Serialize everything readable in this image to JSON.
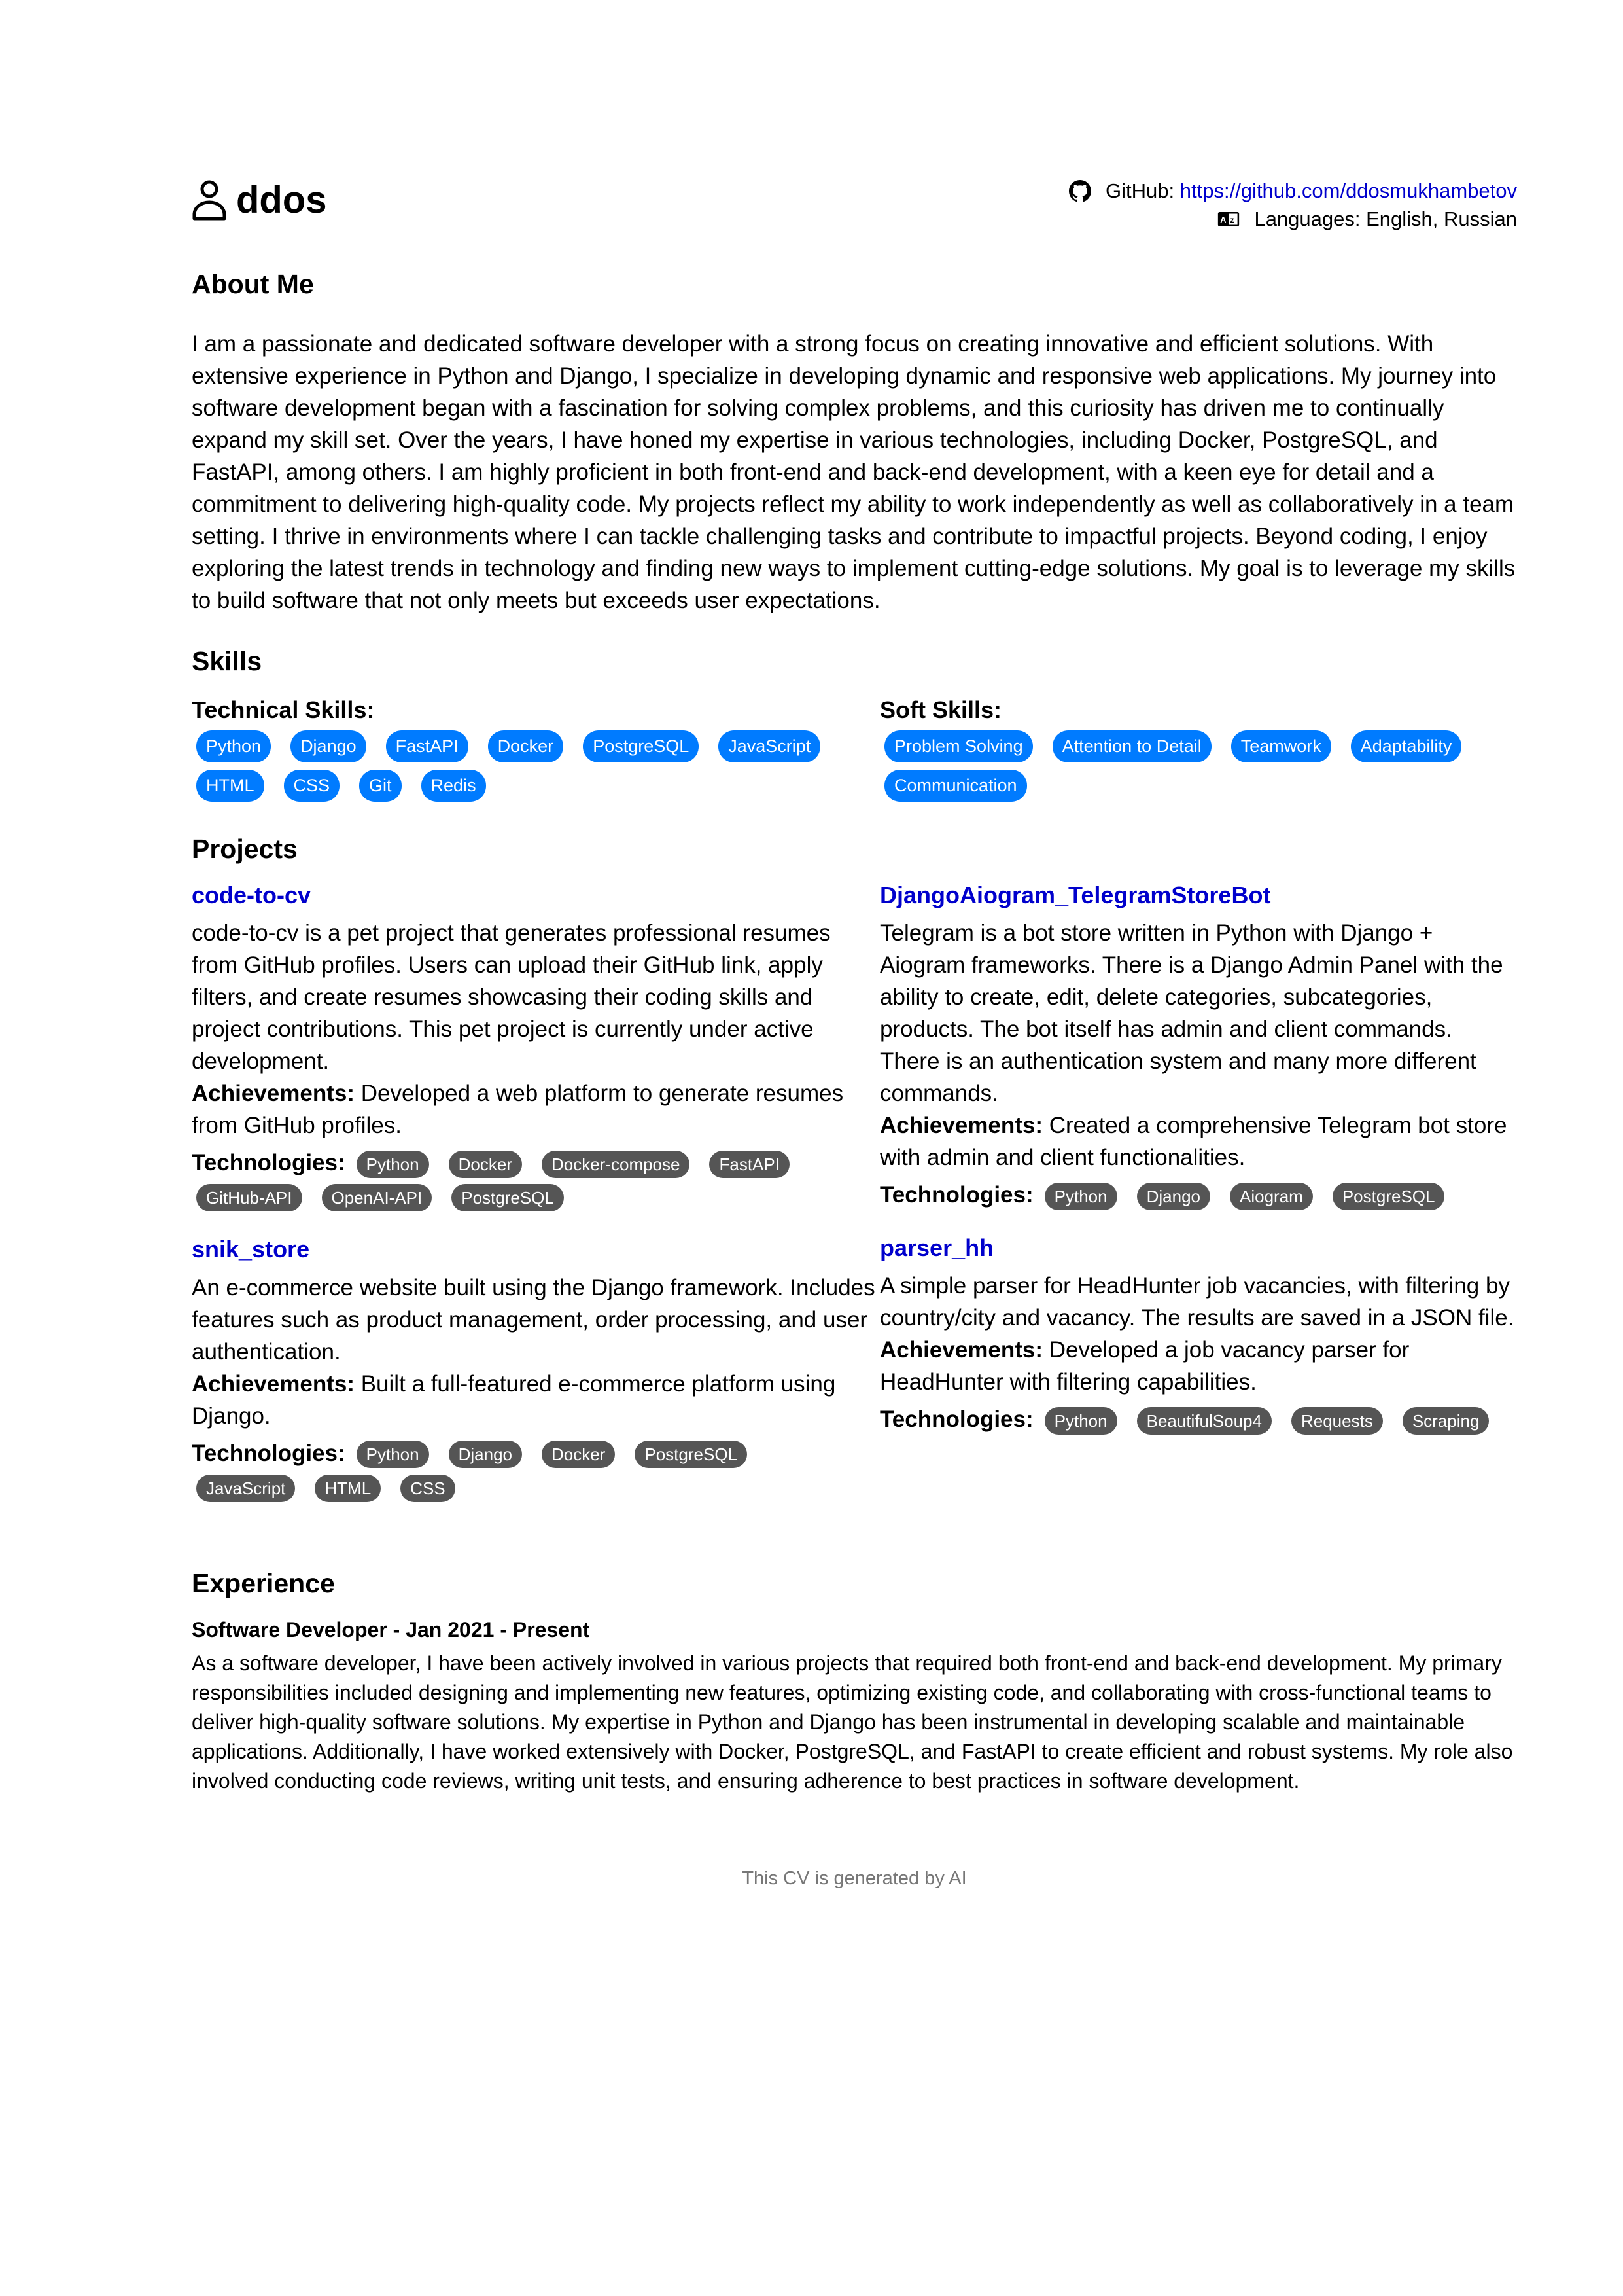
{
  "header": {
    "name": "ddos",
    "github_label": "GitHub: ",
    "github_url": "https://github.com/ddosmukhambetov",
    "languages_label": "Languages: English, Russian"
  },
  "about": {
    "title": "About Me",
    "text": "I am a passionate and dedicated software developer with a strong focus on creating innovative and efficient solutions. With extensive experience in Python and Django, I specialize in developing dynamic and responsive web applications. My journey into software development began with a fascination for solving complex problems, and this curiosity has driven me to continually expand my skill set. Over the years, I have honed my expertise in various technologies, including Docker, PostgreSQL, and FastAPI, among others. I am highly proficient in both front-end and back-end development, with a keen eye for detail and a commitment to delivering high-quality code. My projects reflect my ability to work independently as well as collaboratively in a team setting. I thrive in environments where I can tackle challenging tasks and contribute to impactful projects. Beyond coding, I enjoy exploring the latest trends in technology and finding new ways to implement cutting-edge solutions. My goal is to leverage my skills to build software that not only meets but exceeds user expectations."
  },
  "skills": {
    "title": "Skills",
    "technical_title": "Technical Skills:",
    "technical": [
      "Python",
      "Django",
      "FastAPI",
      "Docker",
      "PostgreSQL",
      "JavaScript",
      "HTML",
      "CSS",
      "Git",
      "Redis"
    ],
    "soft_title": "Soft Skills:",
    "soft": [
      "Problem Solving",
      "Attention to Detail",
      "Teamwork",
      "Adaptability",
      "Communication"
    ]
  },
  "projects": {
    "title": "Projects",
    "achievements_label": "Achievements:",
    "technologies_label": "Technologies:",
    "items": [
      {
        "name": "code-to-cv",
        "description": "code-to-cv is a pet project that generates professional resumes from GitHub profiles. Users can upload their GitHub link, apply filters, and create resumes showcasing their coding skills and project contributions. This pet project is currently under active development.",
        "achievements": "Developed a web platform to generate resumes from GitHub profiles.",
        "technologies": [
          "Python",
          "Docker",
          "Docker-compose",
          "FastAPI",
          "GitHub-API",
          "OpenAI-API",
          "PostgreSQL"
        ]
      },
      {
        "name": "DjangoAiogram_TelegramStoreBot",
        "description": "Telegram is a bot store written in Python with Django + Aiogram frameworks. There is a Django Admin Panel with the ability to create, edit, delete categories, subcategories, products. The bot itself has admin and client commands. There is an authentication system and many more different commands.",
        "achievements": "Created a comprehensive Telegram bot store with admin and client functionalities.",
        "technologies": [
          "Python",
          "Django",
          "Aiogram",
          "PostgreSQL"
        ]
      },
      {
        "name": "snik_store",
        "description": "An e-commerce website built using the Django framework. Includes features such as product management, order processing, and user authentication.",
        "achievements": "Built a full-featured e-commerce platform using Django.",
        "technologies": [
          "Python",
          "Django",
          "Docker",
          "PostgreSQL",
          "JavaScript",
          "HTML",
          "CSS"
        ]
      },
      {
        "name": "parser_hh",
        "description": "A simple parser for HeadHunter job vacancies, with filtering by country/city and vacancy. The results are saved in a JSON file.",
        "achievements": "Developed a job vacancy parser for HeadHunter with filtering capabilities.",
        "technologies": [
          "Python",
          "BeautifulSoup4",
          "Requests",
          "Scraping"
        ]
      }
    ]
  },
  "experience": {
    "title": "Experience",
    "jobs": [
      {
        "title": "Software Developer - Jan 2021 - Present",
        "description": "As a software developer, I have been actively involved in various projects that required both front-end and back-end development. My primary responsibilities included designing and implementing new features, optimizing existing code, and collaborating with cross-functional teams to deliver high-quality software solutions. My expertise in Python and Django has been instrumental in developing scalable and maintainable applications. Additionally, I have worked extensively with Docker, PostgreSQL, and FastAPI to create efficient and robust systems. My role also involved conducting code reviews, writing unit tests, and ensuring adherence to best practices in software development."
      }
    ]
  },
  "footer": {
    "text": "This CV is generated by AI"
  },
  "colors": {
    "link": "#0000cc",
    "skill_pill": "#007bff",
    "tech_pill": "#555555",
    "footer_text": "#777777"
  }
}
